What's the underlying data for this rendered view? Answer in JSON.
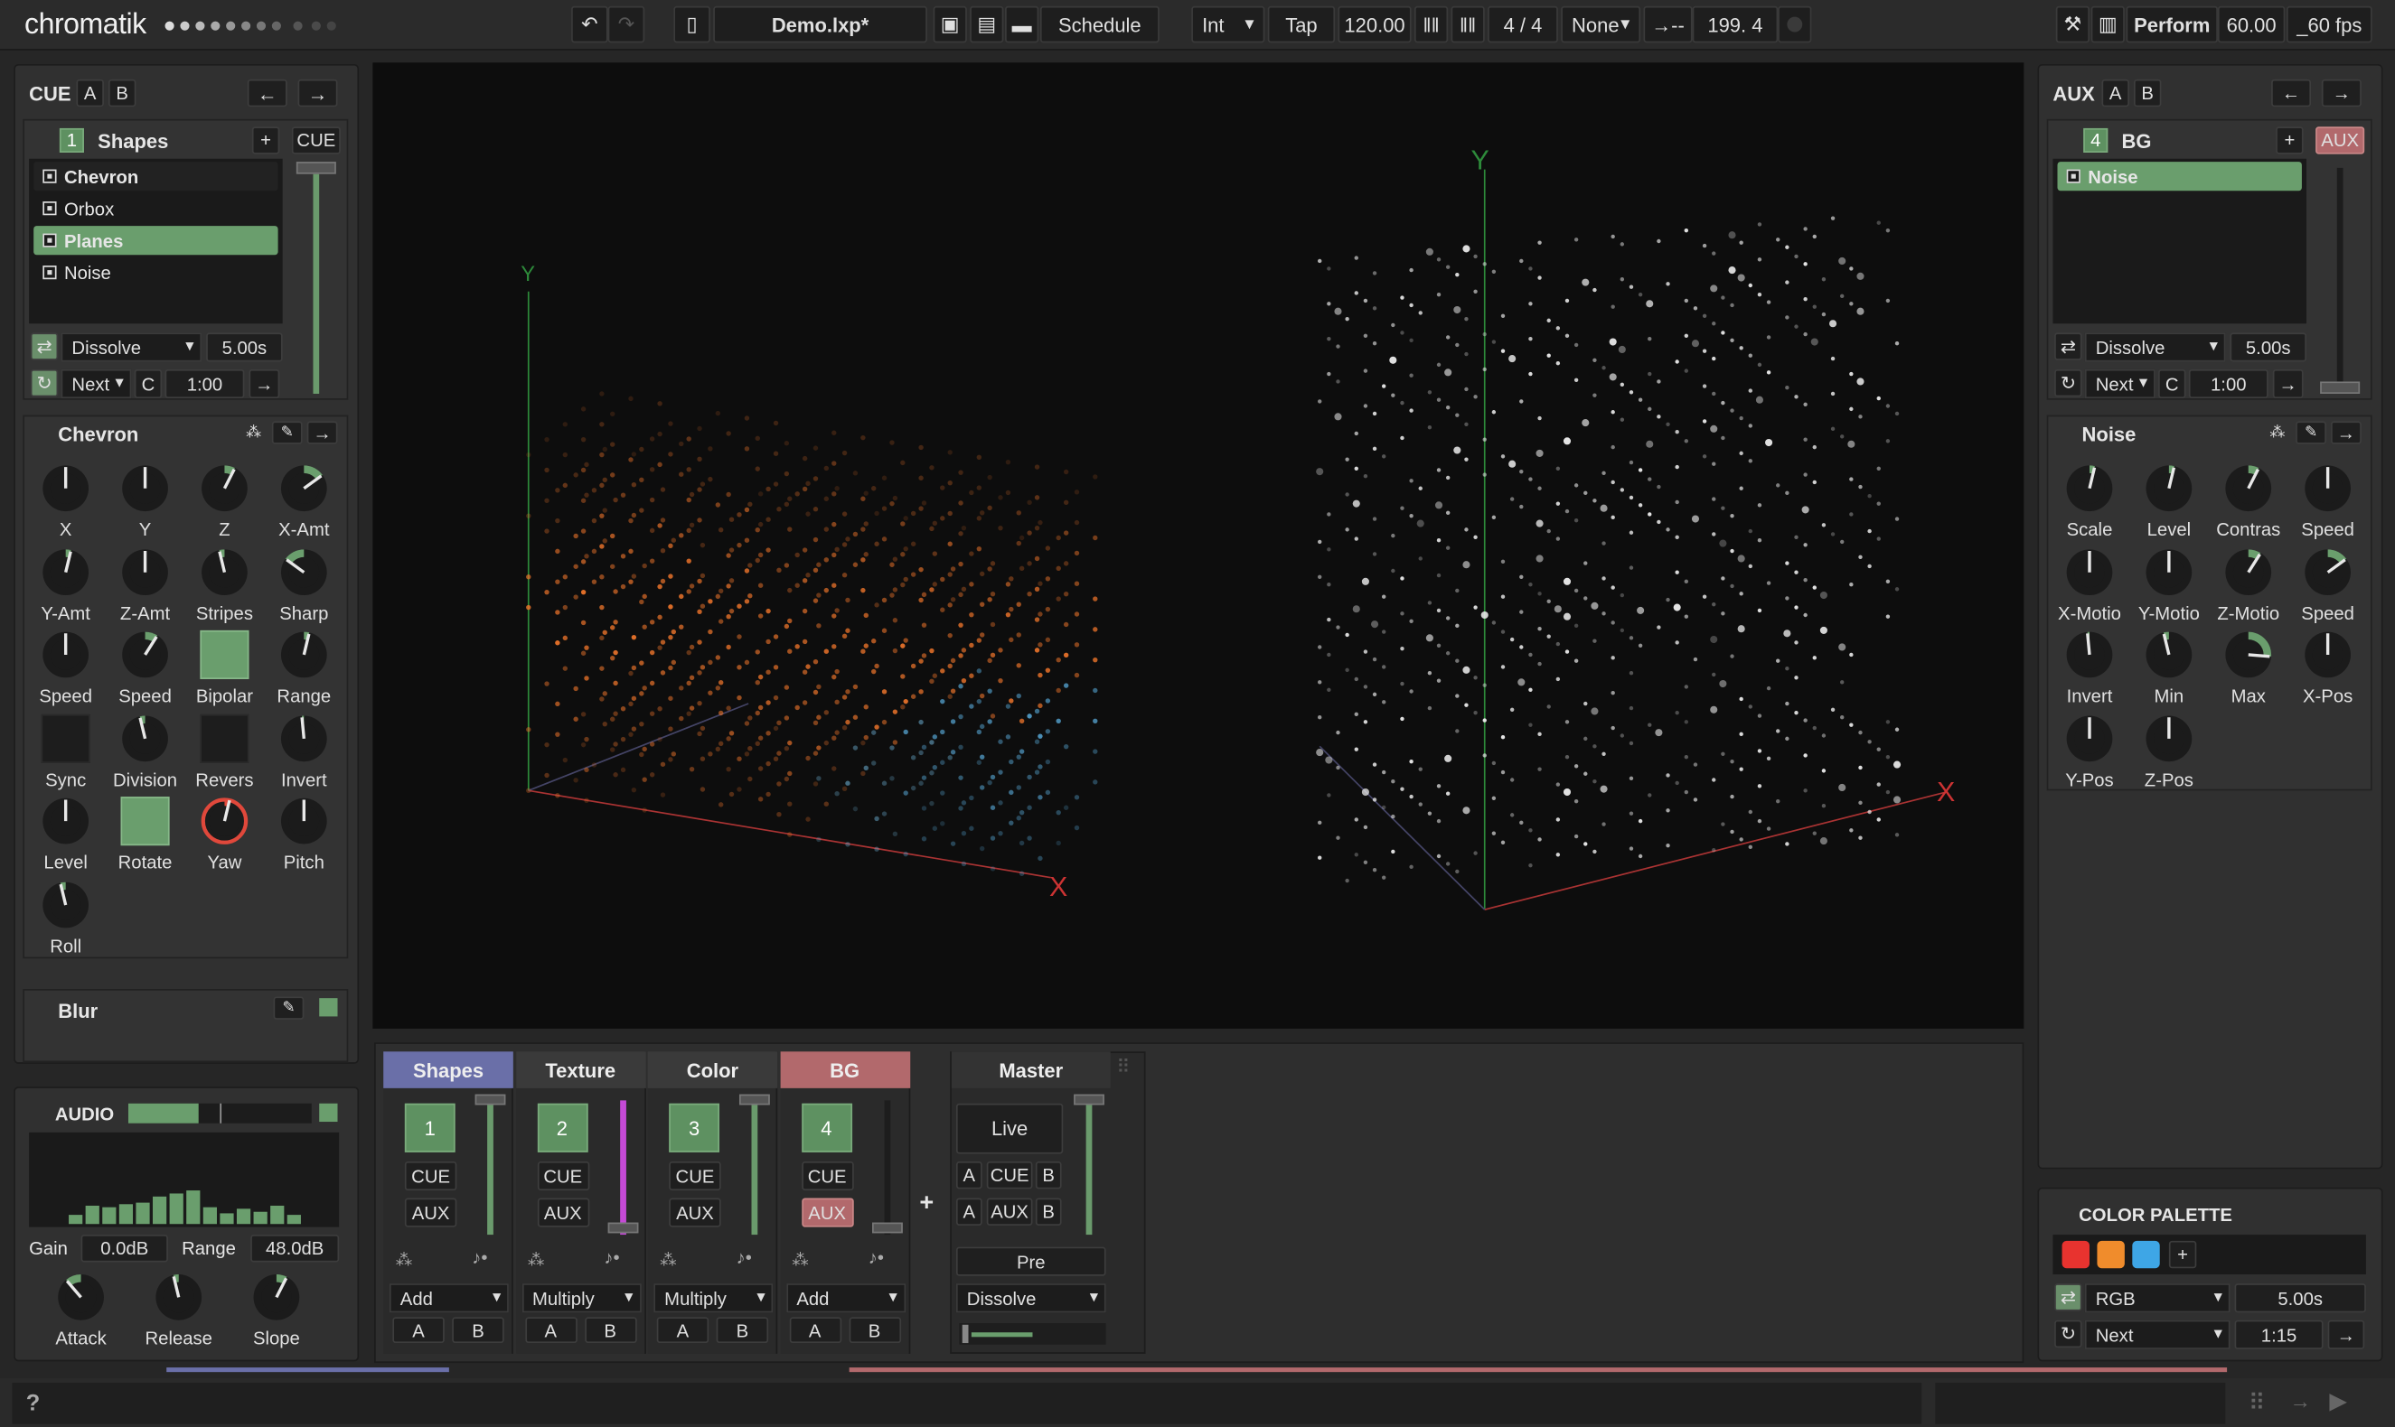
{
  "app": {
    "name": "chromatik"
  },
  "toolbar": {
    "project": "Demo.lxp*",
    "schedule": "Schedule",
    "clock_mode": "Int",
    "tap": "Tap",
    "bpm": "120.00",
    "time_sig": "4 / 4",
    "sync": "None",
    "beat_pos": "199. 4",
    "perform": "Perform",
    "fps_target": "60.00",
    "fps_actual": "_60 fps"
  },
  "cue": {
    "label": "CUE",
    "a": "A",
    "b": "B"
  },
  "aux": {
    "label": "AUX",
    "a": "A",
    "b": "B"
  },
  "shapes_channel": {
    "index": "1",
    "title": "Shapes",
    "cue_button": "CUE",
    "patterns": [
      "Chevron",
      "Orbox",
      "Planes",
      "Noise"
    ],
    "transition": "Dissolve",
    "transition_time": "5.00s",
    "next": "Next",
    "c": "C",
    "cycle_time": "1:00"
  },
  "chevron": {
    "title": "Chevron",
    "knobs": [
      {
        "label": "X",
        "value": 0.5
      },
      {
        "label": "Y",
        "value": 0.5
      },
      {
        "label": "Z",
        "value": 0.6
      },
      {
        "label": "X-Amt",
        "value": 0.7
      },
      {
        "label": "Y-Amt",
        "value": 0.55
      },
      {
        "label": "Z-Amt",
        "value": 0.5
      },
      {
        "label": "Stripes",
        "value": 0.45
      },
      {
        "label": "Sharp",
        "value": 0.3
      },
      {
        "label": "Speed",
        "value": 0.5
      },
      {
        "label": "Speed",
        "value": 0.62
      },
      {
        "label": "Bipolar",
        "toggle": true,
        "on": true
      },
      {
        "label": "Range",
        "value": 0.55
      },
      {
        "label": "Sync",
        "toggle": true,
        "on": false
      },
      {
        "label": "Division",
        "value": 0.45
      },
      {
        "label": "Revers",
        "toggle": true,
        "on": false
      },
      {
        "label": "Invert",
        "value": 0.48
      },
      {
        "label": "Level",
        "value": 0.5
      },
      {
        "label": "Rotate",
        "toggle": true,
        "on": true
      },
      {
        "label": "Yaw",
        "value": 0.55,
        "red": true
      },
      {
        "label": "Pitch",
        "value": 0.5
      },
      {
        "label": "Roll",
        "value": 0.45
      }
    ]
  },
  "blur": {
    "title": "Blur"
  },
  "audio": {
    "title": "AUDIO",
    "gain_label": "Gain",
    "gain": "0.0dB",
    "range_label": "Range",
    "range": "48.0dB",
    "knobs": [
      {
        "label": "Attack",
        "value": 0.35
      },
      {
        "label": "Release",
        "value": 0.45
      },
      {
        "label": "Slope",
        "value": 0.6
      }
    ]
  },
  "bg_channel": {
    "index": "4",
    "title": "BG",
    "aux_button": "AUX",
    "patterns": [
      "Noise"
    ],
    "transition": "Dissolve",
    "transition_time": "5.00s",
    "next": "Next",
    "c": "C",
    "cycle_time": "1:00"
  },
  "noise": {
    "title": "Noise",
    "knobs": [
      {
        "label": "Scale",
        "value": 0.55
      },
      {
        "label": "Level",
        "value": 0.55
      },
      {
        "label": "Contras",
        "value": 0.6
      },
      {
        "label": "Speed",
        "value": 0.5
      },
      {
        "label": "X-Motio",
        "value": 0.5
      },
      {
        "label": "Y-Motio",
        "value": 0.5
      },
      {
        "label": "Z-Motio",
        "value": 0.62
      },
      {
        "label": "Speed",
        "value": 0.7
      },
      {
        "label": "Invert",
        "value": 0.48
      },
      {
        "label": "Min",
        "value": 0.45
      },
      {
        "label": "Max",
        "value": 0.85
      },
      {
        "label": "X-Pos",
        "value": 0.5
      },
      {
        "label": "Y-Pos",
        "value": 0.5
      },
      {
        "label": "Z-Pos",
        "value": 0.5
      }
    ]
  },
  "mixer": {
    "channels": [
      {
        "name": "Shapes",
        "index": "1",
        "cue": "CUE",
        "aux": "AUX",
        "blend": "Add",
        "a": "A",
        "b": "B"
      },
      {
        "name": "Texture",
        "index": "2",
        "cue": "CUE",
        "aux": "AUX",
        "blend": "Multiply",
        "a": "A",
        "b": "B"
      },
      {
        "name": "Color",
        "index": "3",
        "cue": "CUE",
        "aux": "AUX",
        "blend": "Multiply",
        "a": "A",
        "b": "B"
      },
      {
        "name": "BG",
        "index": "4",
        "cue": "CUE",
        "aux": "AUX",
        "blend": "Add",
        "a": "A",
        "b": "B"
      }
    ],
    "master": {
      "name": "Master",
      "live": "Live",
      "a": "A",
      "cue": "CUE",
      "b": "B",
      "aux": "AUX",
      "pre": "Pre",
      "transition": "Dissolve"
    },
    "plus": "+"
  },
  "palette": {
    "title": "COLOR PALETTE",
    "swatches": [
      "#e8332f",
      "#f08c2c",
      "#3ea6e6"
    ],
    "add": "+",
    "mode": "RGB",
    "time": "5.00s",
    "next": "Next",
    "cycle": "1:15"
  },
  "status": {
    "help": "?"
  },
  "colors": {
    "accent": "#5e9161",
    "shapes": "#6a6fa8",
    "bg": "#b2696c"
  }
}
